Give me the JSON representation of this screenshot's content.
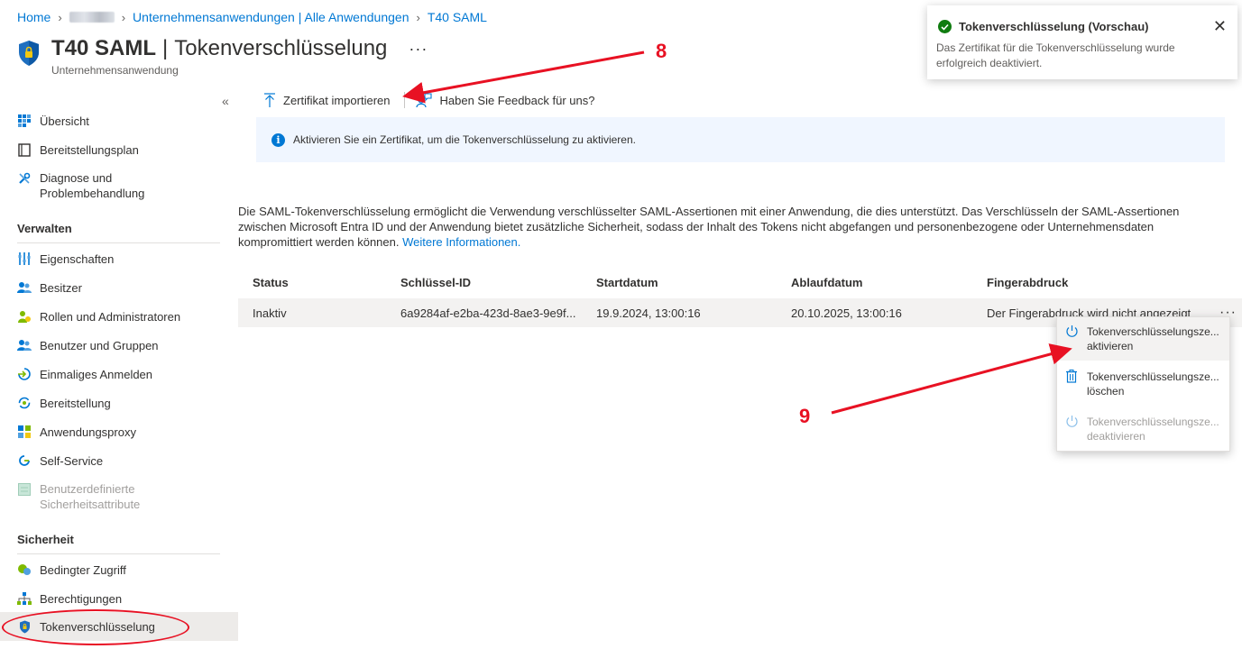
{
  "breadcrumb": {
    "home": "Home",
    "apps": "Unternehmensanwendungen | Alle Anwendungen",
    "current": "T40 SAML"
  },
  "header": {
    "app_name": "T40 SAML",
    "separator": "|",
    "page": "Tokenverschlüsselung",
    "more": "···",
    "subtitle": "Unternehmensanwendung"
  },
  "sidebar": {
    "collapse": "«",
    "top_items": [
      {
        "label": "Übersicht",
        "icon": "overview-icon"
      },
      {
        "label": "Bereitstellungsplan",
        "icon": "book-icon"
      },
      {
        "label_line1": "Diagnose und",
        "label_line2": "Problembehandlung",
        "icon": "wrench-icon"
      }
    ],
    "section_manage": "Verwalten",
    "manage_items": [
      {
        "label": "Eigenschaften",
        "icon": "properties-icon"
      },
      {
        "label": "Besitzer",
        "icon": "owners-icon"
      },
      {
        "label": "Rollen und Administratoren",
        "icon": "roles-icon"
      },
      {
        "label": "Benutzer und Gruppen",
        "icon": "users-icon"
      },
      {
        "label": "Einmaliges Anmelden",
        "icon": "sso-icon"
      },
      {
        "label": "Bereitstellung",
        "icon": "provisioning-icon"
      },
      {
        "label": "Anwendungsproxy",
        "icon": "proxy-icon"
      },
      {
        "label": "Self-Service",
        "icon": "self-service-icon"
      },
      {
        "label_line1": "Benutzerdefinierte",
        "label_line2": "Sicherheitsattribute",
        "icon": "attributes-icon",
        "disabled": true
      }
    ],
    "section_security": "Sicherheit",
    "security_items": [
      {
        "label": "Bedingter Zugriff",
        "icon": "conditional-access-icon"
      },
      {
        "label": "Berechtigungen",
        "icon": "permissions-icon"
      },
      {
        "label": "Tokenverschlüsselung",
        "icon": "shield-icon",
        "active": true
      }
    ]
  },
  "toolbar": {
    "import_label": "Zertifikat importieren",
    "feedback_label": "Haben Sie Feedback für uns?"
  },
  "info": {
    "text": "Aktivieren Sie ein Zertifikat, um die Tokenverschlüsselung zu aktivieren."
  },
  "description": {
    "text": "Die SAML-Tokenverschlüsselung ermöglicht die Verwendung verschlüsselter SAML-Assertionen mit einer Anwendung, die dies unterstützt. Das Verschlüsseln der SAML-Assertionen zwischen Microsoft Entra ID und der Anwendung bietet zusätzliche Sicherheit, sodass der Inhalt des Tokens nicht abgefangen und personenbezogene oder Unternehmensdaten kompromittiert werden können.",
    "link": "Weitere Informationen."
  },
  "table": {
    "headers": {
      "status": "Status",
      "key_id": "Schlüssel-ID",
      "start": "Startdatum",
      "expiry": "Ablaufdatum",
      "thumbprint": "Fingerabdruck"
    },
    "row": {
      "status": "Inaktiv",
      "key_id": "6a9284af-e2ba-423d-8ae3-9e9f...",
      "start": "19.9.2024, 13:00:16",
      "expiry": "20.10.2025, 13:00:16",
      "thumbprint": "Der Fingerabdruck wird nicht angezeigt",
      "more": "···"
    }
  },
  "context_menu": {
    "items": [
      {
        "line1": "Tokenverschlüsselungsze...",
        "line2": "aktivieren",
        "icon": "power-icon"
      },
      {
        "line1": "Tokenverschlüsselungsze...",
        "line2": "löschen",
        "icon": "trash-icon"
      },
      {
        "line1": "Tokenverschlüsselungsze...",
        "line2": "deaktivieren",
        "icon": "power-icon",
        "disabled": true
      }
    ]
  },
  "toast": {
    "title": "Tokenverschlüsselung (Vorschau)",
    "body": "Das Zertifikat für die Tokenverschlüsselung wurde erfolgreich deaktiviert.",
    "close": "✕"
  },
  "annotations": {
    "step8": "8",
    "step9": "9",
    "color": "#e81123"
  }
}
